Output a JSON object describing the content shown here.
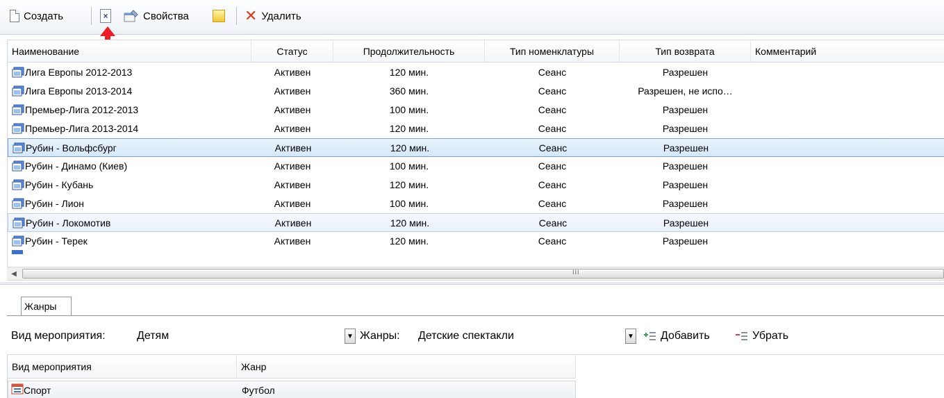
{
  "toolbar": {
    "create_label": "Создать",
    "properties_label": "Свойства",
    "delete_label": "Удалить"
  },
  "grid": {
    "columns": [
      "Наименование",
      "Статус",
      "Продолжительность",
      "Тип номенклатуры",
      "Тип возврата",
      "Комментарий"
    ],
    "rows": [
      {
        "name": "Лига Европы 2012-2013",
        "status": "Активен",
        "duration": "120 мин.",
        "nomenclature": "Сеанс",
        "return_type": "Разрешен",
        "comment": ""
      },
      {
        "name": "Лига Европы 2013-2014",
        "status": "Активен",
        "duration": "360 мин.",
        "nomenclature": "Сеанс",
        "return_type": "Разрешен, не испо…",
        "comment": ""
      },
      {
        "name": "Премьер-Лига 2012-2013",
        "status": "Активен",
        "duration": "100 мин.",
        "nomenclature": "Сеанс",
        "return_type": "Разрешен",
        "comment": ""
      },
      {
        "name": "Премьер-Лига 2013-2014",
        "status": "Активен",
        "duration": "120 мин.",
        "nomenclature": "Сеанс",
        "return_type": "Разрешен",
        "comment": ""
      },
      {
        "name": "Рубин - Вольфсбург",
        "status": "Активен",
        "duration": "120 мин.",
        "nomenclature": "Сеанс",
        "return_type": "Разрешен",
        "comment": ""
      },
      {
        "name": "Рубин - Динамо (Киев)",
        "status": "Активен",
        "duration": "100 мин.",
        "nomenclature": "Сеанс",
        "return_type": "Разрешен",
        "comment": ""
      },
      {
        "name": "Рубин - Кубань",
        "status": "Активен",
        "duration": "120 мин.",
        "nomenclature": "Сеанс",
        "return_type": "Разрешен",
        "comment": ""
      },
      {
        "name": "Рубин - Лион",
        "status": "Активен",
        "duration": "100 мин.",
        "nomenclature": "Сеанс",
        "return_type": "Разрешен",
        "comment": ""
      },
      {
        "name": "Рубин - Локомотив",
        "status": "Активен",
        "duration": "120 мин.",
        "nomenclature": "Сеанс",
        "return_type": "Разрешен",
        "comment": ""
      },
      {
        "name": "Рубин - Терек",
        "status": "Активен",
        "duration": "120 мин.",
        "nomenclature": "Сеанс",
        "return_type": "Разрешен",
        "comment": ""
      }
    ],
    "selected_row_index": 4,
    "highlighted_row_index": 8
  },
  "tabs": [
    "Жанры"
  ],
  "filter": {
    "event_type_label": "Вид мероприятия:",
    "event_type_value": "Детям",
    "genres_label": "Жанры:",
    "genres_value": "Детские спектакли",
    "add_label": "Добавить",
    "remove_label": "Убрать"
  },
  "genre_grid": {
    "columns": [
      "Вид мероприятия",
      "Жанр"
    ],
    "rows": [
      {
        "event_type": "Спорт",
        "genre": "Футбол"
      }
    ]
  },
  "icons": {
    "create": "new-document-icon",
    "clear": "clear-document-icon",
    "properties": "properties-icon",
    "note": "note-icon",
    "delete": "delete-icon",
    "event_row": "event-icon",
    "add": "list-add-icon",
    "remove": "list-remove-icon"
  },
  "colors": {
    "selection_border": "#7da2ce",
    "selection_fill": "#d6e8fb",
    "delete_red": "#e03a1a",
    "arrow_red": "#ee1c24"
  }
}
